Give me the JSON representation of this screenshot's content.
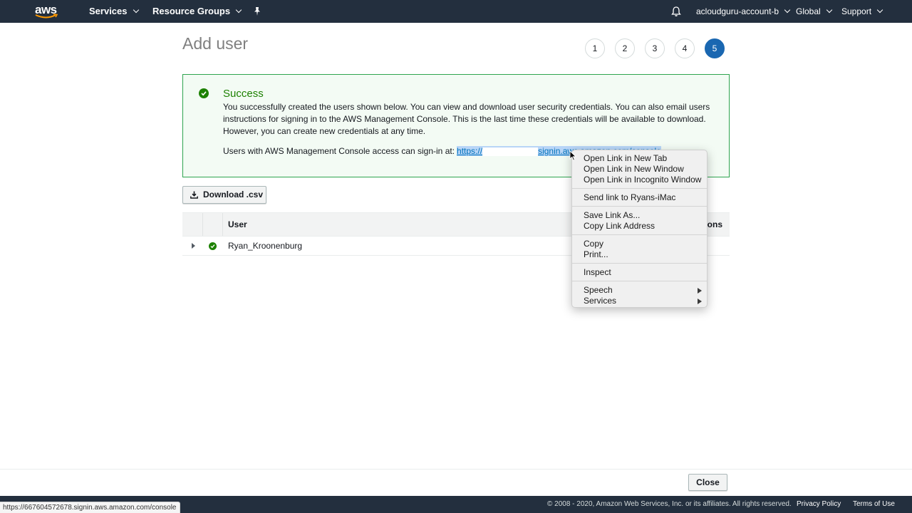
{
  "topnav": {
    "logo_text": "aws",
    "services_label": "Services",
    "resource_groups_label": "Resource Groups",
    "account_label": "acloudguru-account-b",
    "region_label": "Global",
    "support_label": "Support",
    "icons": [
      "pin-icon",
      "bell-icon",
      "chevron-down-icon"
    ]
  },
  "page": {
    "title": "Add user",
    "steps": [
      "1",
      "2",
      "3",
      "4",
      "5"
    ],
    "active_step": "5"
  },
  "success": {
    "title": "Success",
    "message": "You successfully created the users shown below. You can view and download user security credentials. You can also email users instructions for signing in to the AWS Management Console. This is the last time these credentials will be available to download. However, you can create new credentials at any time.",
    "signin_prefix": "Users with AWS Management Console access can sign-in at:",
    "signin_link_start": "https://",
    "signin_link_end": "signin.aws.amazon.com/console"
  },
  "download_label": "Download .csv",
  "table": {
    "columns": [
      "User",
      "ons"
    ],
    "rows": [
      {
        "user": "Ryan_Kroonenburg",
        "status": "success"
      }
    ]
  },
  "context_menu": {
    "items": [
      "Open Link in New Tab",
      "Open Link in New Window",
      "Open Link in Incognito Window",
      "Send link to Ryans-iMac",
      "Save Link As...",
      "Copy Link Address",
      "Copy",
      "Print...",
      "Inspect",
      "Speech",
      "Services"
    ]
  },
  "close_label": "Close",
  "footer": {
    "copyright": "© 2008 - 2020, Amazon Web Services, Inc. or its affiliates. All rights reserved.",
    "privacy": "Privacy Policy",
    "terms": "Terms of Use"
  },
  "status_bar_url": "https://667604572678.signin.aws.amazon.com/console",
  "colors": {
    "nav_bg": "#232f3e",
    "success_green": "#1d8102",
    "active_step_blue": "#1a67b1",
    "link_blue": "#0073bb"
  }
}
